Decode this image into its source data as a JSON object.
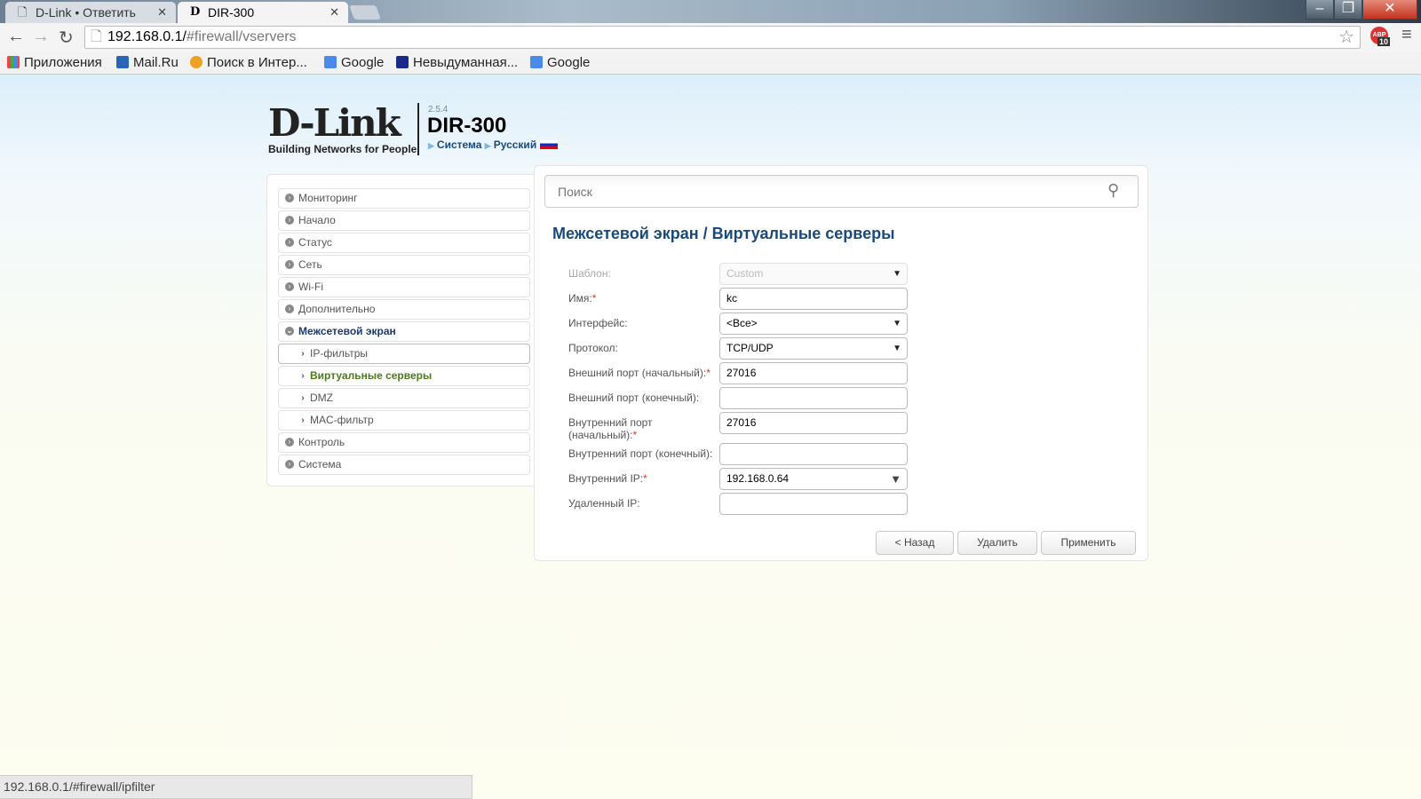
{
  "browser": {
    "tabs": [
      {
        "label": "D-Link • Ответить"
      },
      {
        "label": "DIR-300"
      }
    ],
    "url_host": "192.168.0.1/",
    "url_path": "#firewall/vservers",
    "bookmarks": [
      "Приложения",
      "Mail.Ru",
      "Поиск в Интер...",
      "Google",
      "Невыдуманная...",
      "Google"
    ],
    "abp_count": "10",
    "status_url": "192.168.0.1/#firewall/ipfilter"
  },
  "header": {
    "logo": "D-Link",
    "tagline": "Building Networks for People",
    "version": "2.5.4",
    "model": "DIR-300",
    "crumb_system": "Система",
    "crumb_lang": "Русский"
  },
  "menu": [
    {
      "label": "Мониторинг"
    },
    {
      "label": "Начало"
    },
    {
      "label": "Статус"
    },
    {
      "label": "Сеть"
    },
    {
      "label": "Wi-Fi"
    },
    {
      "label": "Дополнительно"
    },
    {
      "label": "Межсетевой экран"
    },
    {
      "label": "IP-фильтры"
    },
    {
      "label": "Виртуальные серверы"
    },
    {
      "label": "DMZ"
    },
    {
      "label": "MAC-фильтр"
    },
    {
      "label": "Контроль"
    },
    {
      "label": "Система"
    }
  ],
  "main": {
    "search_placeholder": "Поиск",
    "title": "Межсетевой экран /  Виртуальные серверы",
    "fields": [
      {
        "label": "Шаблон:",
        "value": "Custom"
      },
      {
        "label": "Имя:",
        "value": "kc"
      },
      {
        "label": "Интерфейс:",
        "value": "<Все>"
      },
      {
        "label": "Протокол:",
        "value": "TCP/UDP"
      },
      {
        "label": "Внешний порт (начальный):",
        "value": "27016"
      },
      {
        "label": "Внешний порт (конечный):",
        "value": ""
      },
      {
        "label": "Внутренний порт (начальный):",
        "value": "27016"
      },
      {
        "label": "Внутренний порт (конечный):",
        "value": ""
      },
      {
        "label": "Внутренний IP:",
        "value": "192.168.0.64"
      },
      {
        "label": "Удаленный IP:",
        "value": ""
      }
    ],
    "required_mark": "*",
    "buttons": {
      "back": "< Назад",
      "delete": "Удалить",
      "apply": "Применить"
    }
  }
}
